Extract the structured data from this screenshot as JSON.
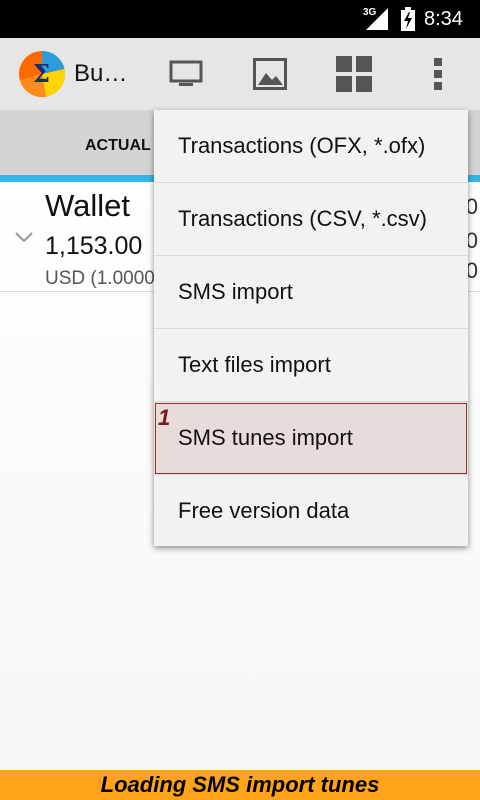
{
  "status_bar": {
    "network": "3G",
    "time": "8:34",
    "icons": [
      "signal-icon",
      "battery-charging-icon"
    ]
  },
  "action_bar": {
    "title": "Bu…",
    "logo": "sigma-logo",
    "icons": [
      "monitor-icon",
      "image-icon",
      "grid-icon",
      "overflow-menu-icon"
    ]
  },
  "tabs": [
    {
      "label": "ACTUAL"
    }
  ],
  "colors": {
    "tab_indicator": "#33b5e5",
    "banner": "#ffa31a",
    "highlight_border": "#8b3a3a"
  },
  "account": {
    "name": "Wallet",
    "balance": "1,153.00",
    "currency": "USD (1.0000",
    "right_values": [
      "0",
      "0",
      "0"
    ]
  },
  "menu": {
    "items": [
      {
        "label": "Transactions (OFX, *.ofx)"
      },
      {
        "label": "Transactions (CSV, *.csv)"
      },
      {
        "label": "SMS import"
      },
      {
        "label": "Text files import"
      },
      {
        "label": "SMS tunes import"
      },
      {
        "label": "Free version data"
      }
    ],
    "step_marker": "1"
  },
  "banner": {
    "text": "Loading SMS import tunes"
  }
}
